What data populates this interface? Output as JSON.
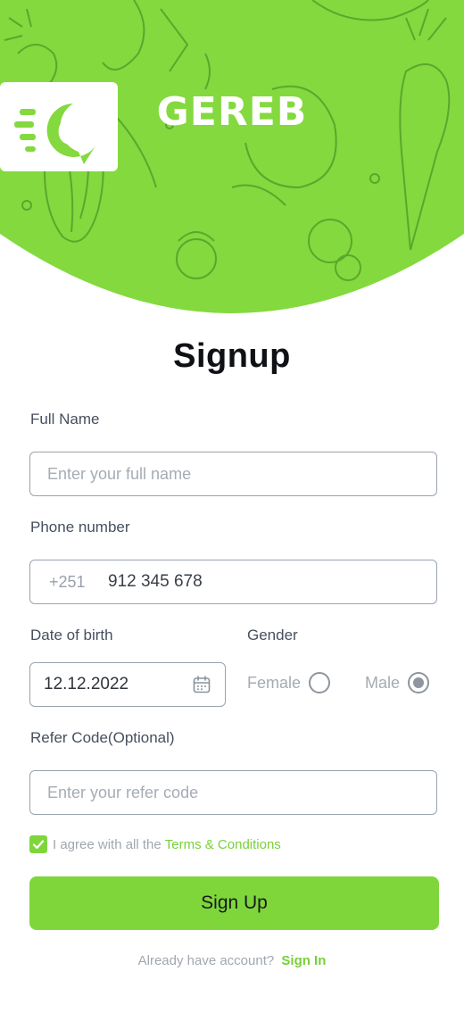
{
  "brand": {
    "name": "GEREB",
    "badge_letter": "G",
    "accent_color": "#7fd63b"
  },
  "page": {
    "title": "Signup"
  },
  "form": {
    "full_name": {
      "label": "Full Name",
      "placeholder": "Enter your full name"
    },
    "phone": {
      "label": "Phone number",
      "prefix": "+251",
      "value": "912 345 678"
    },
    "dob": {
      "label": "Date of birth",
      "value": "12.12.2022",
      "icon": "calendar-icon"
    },
    "gender": {
      "label": "Gender",
      "options": [
        {
          "label": "Female",
          "selected": false
        },
        {
          "label": "Male",
          "selected": true
        }
      ]
    },
    "refer": {
      "label": "Refer Code(Optional)",
      "placeholder": "Enter your refer code"
    },
    "agree": {
      "text": "I agree with all the",
      "link": "Terms & Conditions",
      "checked": true
    },
    "submit_label": "Sign Up"
  },
  "footer": {
    "text": "Already have account?",
    "link": "Sign In"
  }
}
